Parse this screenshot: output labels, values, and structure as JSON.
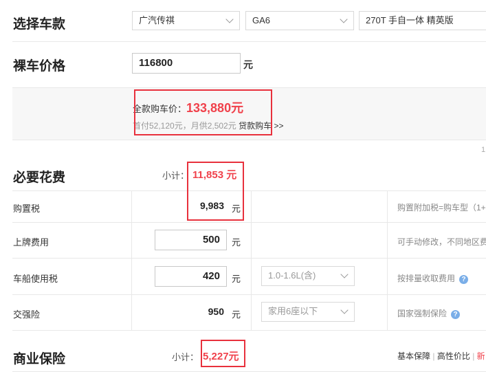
{
  "select_model": {
    "title": "选择车款",
    "brand": "广汽传祺",
    "series": "GA6",
    "trim": "270T 手自一体 精英版"
  },
  "bare_price": {
    "title": "裸车价格",
    "value": "116800",
    "unit": "元"
  },
  "full_price": {
    "label": "全款购车价：",
    "value": "133,880元",
    "loan_text": "首付52,120元，月供2,502元",
    "loan_link": "贷款购车",
    "loan_arrow": ">>"
  },
  "scroll_hint": "1",
  "required_fees": {
    "title": "必要花费",
    "subtotal_label": "小计：",
    "subtotal_value": "11,853 元",
    "rows": {
      "purchase_tax": {
        "label": "购置税",
        "value": "9,983",
        "unit": "元",
        "note": "购置附加税=购车型（1+"
      },
      "plate_fee": {
        "label": "上牌费用",
        "value": "500",
        "unit": "元",
        "note": "可手动修改，不同地区费"
      },
      "vehicle_tax": {
        "label": "车船使用税",
        "value": "420",
        "unit": "元",
        "option": "1.0-1.6L(含)",
        "note": "按排量收取费用"
      },
      "compulsory_insurance": {
        "label": "交强险",
        "value": "950",
        "unit": "元",
        "option": "家用6座以下",
        "note": "国家强制保险"
      }
    }
  },
  "commercial_insurance": {
    "title": "商业保险",
    "subtotal_label": "小计：",
    "subtotal_value": "5,227元",
    "tabs": [
      "基本保障",
      "高性价比",
      "新"
    ]
  },
  "colors": {
    "accent_red": "#f0414b",
    "help_blue": "#7aaee8",
    "annotation_red": "#e8303c"
  },
  "icons": {
    "dropdown": "chevron-down-icon",
    "help": "question-circle-icon"
  }
}
